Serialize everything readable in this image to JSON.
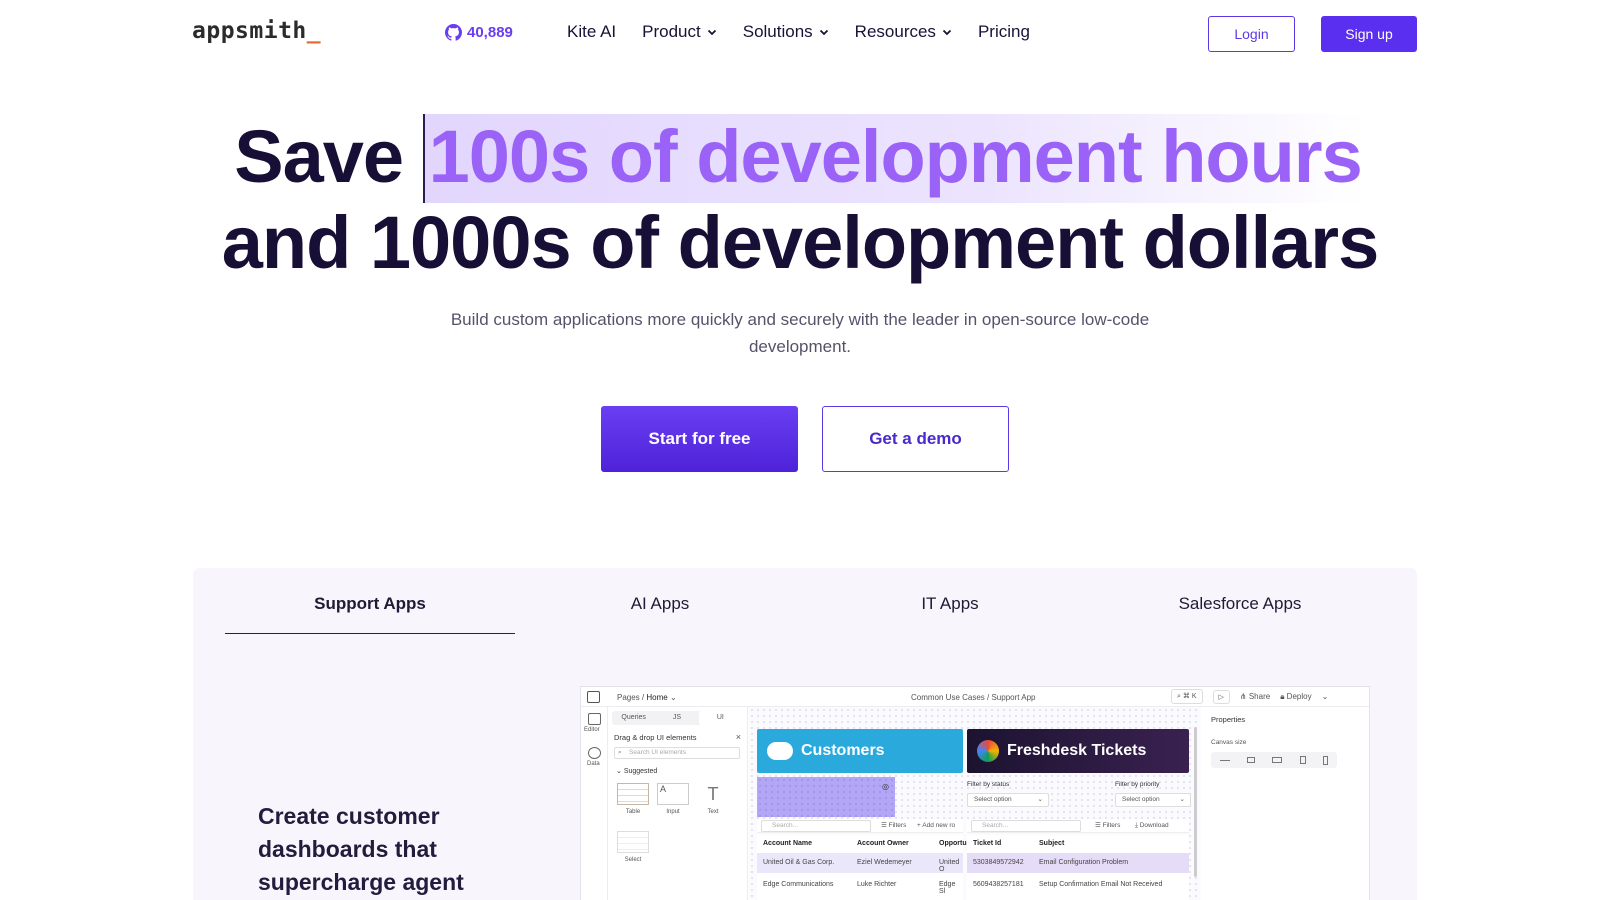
{
  "nav": {
    "logo": "appsmith",
    "logo_cursor": "_",
    "github_stars": "40,889",
    "items": [
      {
        "label": "Kite AI",
        "dropdown": false
      },
      {
        "label": "Product",
        "dropdown": true
      },
      {
        "label": "Solutions",
        "dropdown": true
      },
      {
        "label": "Resources",
        "dropdown": true
      },
      {
        "label": "Pricing",
        "dropdown": false
      }
    ],
    "login": "Login",
    "signup": "Sign up"
  },
  "hero": {
    "line1_prefix": "Save",
    "line1_highlight": "100s of development hours",
    "line2": "and 1000s of development dollars",
    "subtitle": "Build custom applications more quickly and securely with the leader in open-source low-code development.",
    "cta_primary": "Start for free",
    "cta_secondary": "Get a demo"
  },
  "showcase": {
    "tabs": [
      "Support Apps",
      "AI Apps",
      "IT Apps",
      "Salesforce Apps"
    ],
    "active_tab": "Support Apps",
    "feature_title": "Create customer dashboards that supercharge agent"
  },
  "mockup": {
    "breadcrumb_pages": "Pages /",
    "breadcrumb_home": "Home",
    "center_path": "Common Use Cases / Support App",
    "search_shortcut": "⌘ K",
    "share": "Share",
    "deploy": "Deploy",
    "rail_editor": "Editor",
    "rail_data": "Data",
    "segments": [
      "Queries",
      "JS",
      "UI"
    ],
    "panel_title": "Drag & drop UI elements",
    "search_placeholder": "Search UI elements",
    "suggested": "Suggested",
    "widgets": [
      "Table",
      "Input",
      "Text",
      "Select"
    ],
    "card_customers": "Customers",
    "card_tickets": "Freshdesk Tickets",
    "filter_status": "Filter by status",
    "filter_priority": "Filter by priority",
    "select_option": "Select option",
    "search": "Search...",
    "filters": "Filters",
    "add_new": "Add new ro",
    "download": "Download",
    "customers_cols": [
      "Account Name",
      "Account Owner",
      "Opportu"
    ],
    "customers_rows": [
      [
        "United Oil & Gas Corp.",
        "Eziel Wedemeyer",
        "United O"
      ],
      [
        "Edge Communications",
        "Luke Richter",
        "Edge Sl"
      ]
    ],
    "tickets_cols": [
      "Ticket Id",
      "Subject"
    ],
    "tickets_rows": [
      [
        "5303849572942",
        "Email Configuration Problem"
      ],
      [
        "5609438257181",
        "Setup Confirmation Email Not Received"
      ]
    ],
    "properties": "Properties",
    "canvas_size": "Canvas size"
  },
  "colors": {
    "brand": "#5b2ff0",
    "highlight_text": "#9a62f7",
    "customers_card": "#2aa9dc",
    "tickets_card": "#2a1840"
  }
}
